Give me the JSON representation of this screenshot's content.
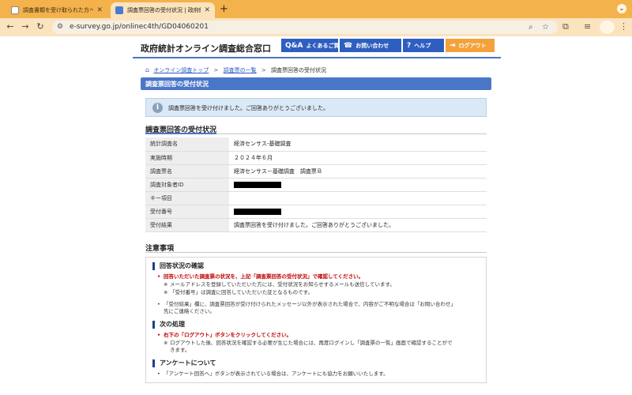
{
  "browser": {
    "tabs": [
      {
        "title": "調査書類を受け取られた方へ | 統",
        "active": false
      },
      {
        "title": "調査票回答の受付状況 | 政府統計",
        "active": true
      }
    ],
    "new_tab_label": "+",
    "url": "e-survey.go.jp/onlinec4th/GD04060201"
  },
  "header": {
    "site_title": "政府統計オンライン調査総合窓口",
    "buttons": [
      {
        "label": "よくあるご質問",
        "icon": "qa-icon"
      },
      {
        "label": "お問い合わせ",
        "icon": "phone-icon"
      },
      {
        "label": "ヘルプ",
        "icon": "question-icon"
      },
      {
        "label": "ログアウト",
        "icon": "logout-icon"
      }
    ]
  },
  "breadcrumb": {
    "home": "オンライン調査トップ",
    "list": "調査票の一覧",
    "current": "調査票回答の受付状況",
    "sep": ">"
  },
  "page_title": "調査票回答の受付状況",
  "info_message": "調査票回答を受け付けました。ご回答ありがとうございました。",
  "section_title": "調査票回答の受付状況",
  "table": [
    {
      "label": "統計調査名",
      "value": "経済センサス-基礎調査",
      "redacted": false
    },
    {
      "label": "実施時期",
      "value": "２０２４年６月",
      "redacted": false
    },
    {
      "label": "調査票名",
      "value": "経済センサス－基礎調査　調査票Ｂ",
      "redacted": false
    },
    {
      "label": "調査対象者ID",
      "value": "",
      "redacted": true
    },
    {
      "label": "キー項目",
      "value": "",
      "redacted": false
    },
    {
      "label": "受付番号",
      "value": "",
      "redacted": true
    },
    {
      "label": "受付結果",
      "value": "調査票回答を受け付けました。ご回答ありがとうございました。",
      "redacted": false
    }
  ],
  "notes": {
    "title": "注意事項",
    "sections": [
      {
        "heading": "回答状況の確認",
        "lines": [
          {
            "text": "回答いただいた調査票の状況を、上記「調査票回答の受付状況」で確認してください。",
            "bullet": "•",
            "style": "red"
          },
          {
            "text": "メールアドレスを登録していただいた方には、受付状況をお知らせするメールも送信しています。",
            "bullet": "※",
            "style": "sub"
          },
          {
            "text": "「受付番号」は調査に回答していただいた証となるものです。",
            "bullet": "※",
            "style": "sub"
          },
          {
            "text": "「受付結果」欄に、調査票回答が受け付けられたメッセージ以外が表示された場合で、内容がご不明な場合は「お問い合わせ」",
            "bullet": "•",
            "style": "normal"
          },
          {
            "text": "先にご連絡ください。",
            "bullet": "",
            "style": "normal"
          }
        ]
      },
      {
        "heading": "次の処理",
        "lines": [
          {
            "text": "右下の「ログアウト」ボタンをクリックしてください。",
            "bullet": "•",
            "style": "red"
          },
          {
            "text": "ログアウトした後、回答状況を確認する必要が生じた場合には、再度ログインし「調査票の一覧」画面で確認することがで",
            "bullet": "※",
            "style": "sub"
          },
          {
            "text": "きます。",
            "bullet": "",
            "style": "sub"
          }
        ]
      },
      {
        "heading": "アンケートについて",
        "lines": [
          {
            "text": "「アンケート回答へ」ボタンが表示されている場合は、アンケートにも協力をお願いいたします。",
            "bullet": "•",
            "style": "normal"
          }
        ]
      }
    ]
  },
  "colors": {
    "accent_blue": "#4a76c8",
    "header_button": "#2e5fc0",
    "logout_button": "#f3a23b",
    "alert_red": "#c00000",
    "browser_tabstrip": "#f3b24c"
  }
}
